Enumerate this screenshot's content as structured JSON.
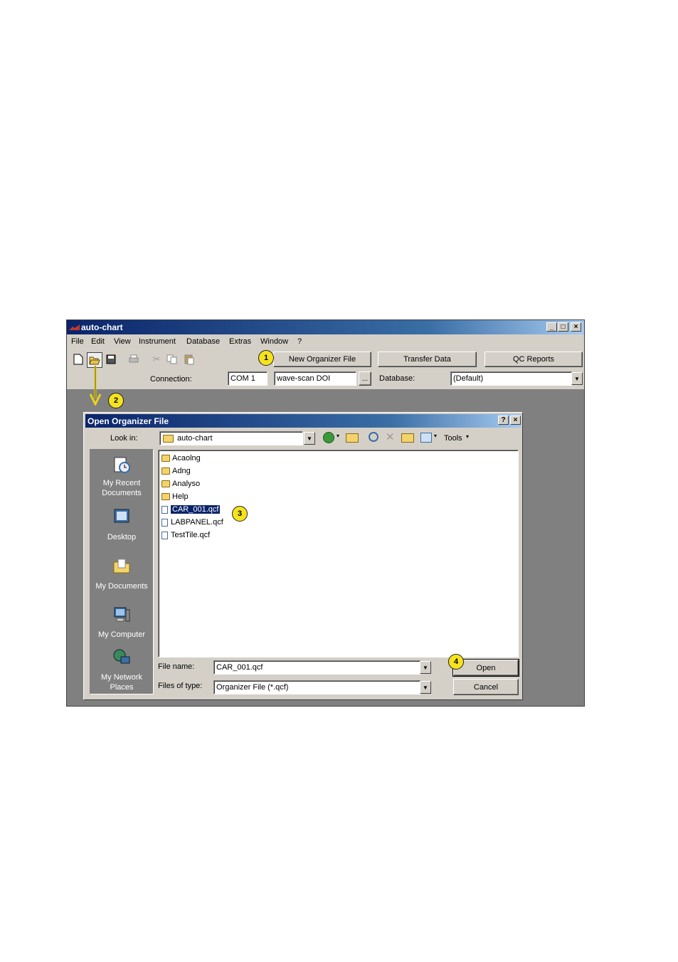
{
  "app": {
    "title": "auto-chart",
    "controls": [
      "_",
      "□",
      "×"
    ]
  },
  "menu": [
    "File",
    "Edit",
    "View",
    "Instrument",
    "Database",
    "Extras",
    "Window",
    "?"
  ],
  "toolbar": {
    "icons": [
      "new-icon",
      "open-icon",
      "save-icon",
      "print-icon",
      "cut-icon",
      "copy-icon",
      "paste-icon"
    ],
    "new_organizer_label": "New Organizer File",
    "transfer_label": "Transfer Data",
    "qc_reports_label": "QC Reports",
    "connection_label": "Connection:",
    "connection_port": "COM 1",
    "connection_device": "wave-scan DOI",
    "browse_label": "...",
    "database_label": "Database:",
    "database_value": "(Default)"
  },
  "callouts": [
    "1",
    "2",
    "3",
    "4"
  ],
  "dialog": {
    "title": "Open Organizer File",
    "help": "?",
    "close": "×",
    "lookin_label": "Look in:",
    "lookin_value": "auto-chart",
    "tools_label": "Tools",
    "places": [
      {
        "label1": "My Recent",
        "label2": "Documents"
      },
      {
        "label1": "Desktop",
        "label2": ""
      },
      {
        "label1": "My Documents",
        "label2": ""
      },
      {
        "label1": "My Computer",
        "label2": ""
      },
      {
        "label1": "My Network",
        "label2": "Places"
      }
    ],
    "files": [
      {
        "name": "Acaolng",
        "type": "folder"
      },
      {
        "name": "Adng",
        "type": "folder"
      },
      {
        "name": "Analyso",
        "type": "folder"
      },
      {
        "name": "Help",
        "type": "folder"
      },
      {
        "name": "CAR_001.qcf",
        "type": "file",
        "selected": true
      },
      {
        "name": "LABPANEL.qcf",
        "type": "file"
      },
      {
        "name": "TestTile.qcf",
        "type": "file"
      }
    ],
    "filename_label": "File name:",
    "filename_value": "CAR_001.qcf",
    "filetype_label": "Files of type:",
    "filetype_value": "Organizer File (*.qcf)",
    "open_label": "Open",
    "cancel_label": "Cancel"
  },
  "colors": {
    "titlebar": "#0a246a",
    "face": "#d4d0c8",
    "workspace": "#808080",
    "callout": "#f5e31d"
  }
}
